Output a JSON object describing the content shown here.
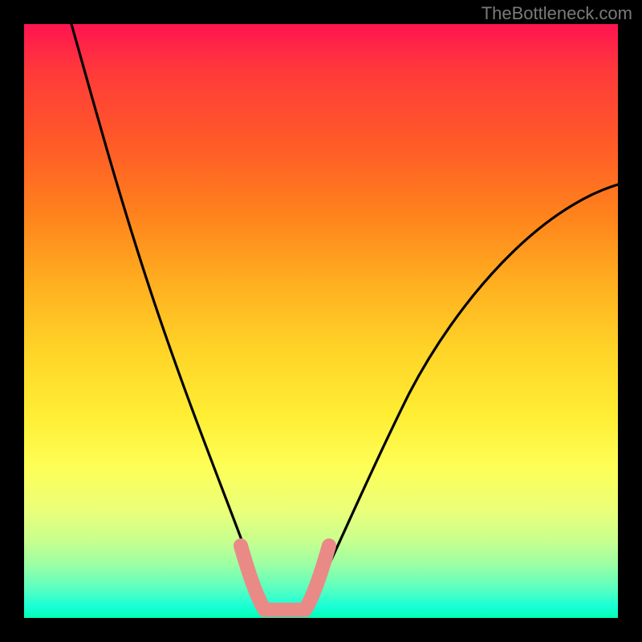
{
  "watermark": "TheBottleneck.com",
  "chart_data": {
    "type": "line",
    "title": "",
    "xlabel": "",
    "ylabel": "",
    "xlim": [
      0,
      100
    ],
    "ylim": [
      0,
      100
    ],
    "background": {
      "kind": "vertical-gradient",
      "meaning": "bottleneck severity (red high, green low)",
      "stops": [
        {
          "pos": 0,
          "color": "#ff1450"
        },
        {
          "pos": 50,
          "color": "#ffd428"
        },
        {
          "pos": 100,
          "color": "#00ffb4"
        }
      ]
    },
    "series": [
      {
        "name": "bottleneck-curve",
        "color": "#000000",
        "x": [
          8,
          12,
          16,
          20,
          24,
          28,
          32,
          35,
          37,
          39,
          40,
          42,
          44,
          46,
          48,
          52,
          58,
          66,
          76,
          88,
          100
        ],
        "values": [
          100,
          85,
          71,
          58,
          46,
          34,
          22,
          12,
          6,
          2,
          0,
          0,
          0,
          2,
          6,
          14,
          26,
          40,
          54,
          66,
          72
        ]
      },
      {
        "name": "optimal-range-marker",
        "color": "#e98a86",
        "x": [
          35.5,
          37,
          39,
          41,
          43,
          45,
          46.5
        ],
        "values": [
          9,
          3,
          0.5,
          0,
          0.5,
          3,
          9
        ]
      }
    ],
    "annotations": []
  }
}
